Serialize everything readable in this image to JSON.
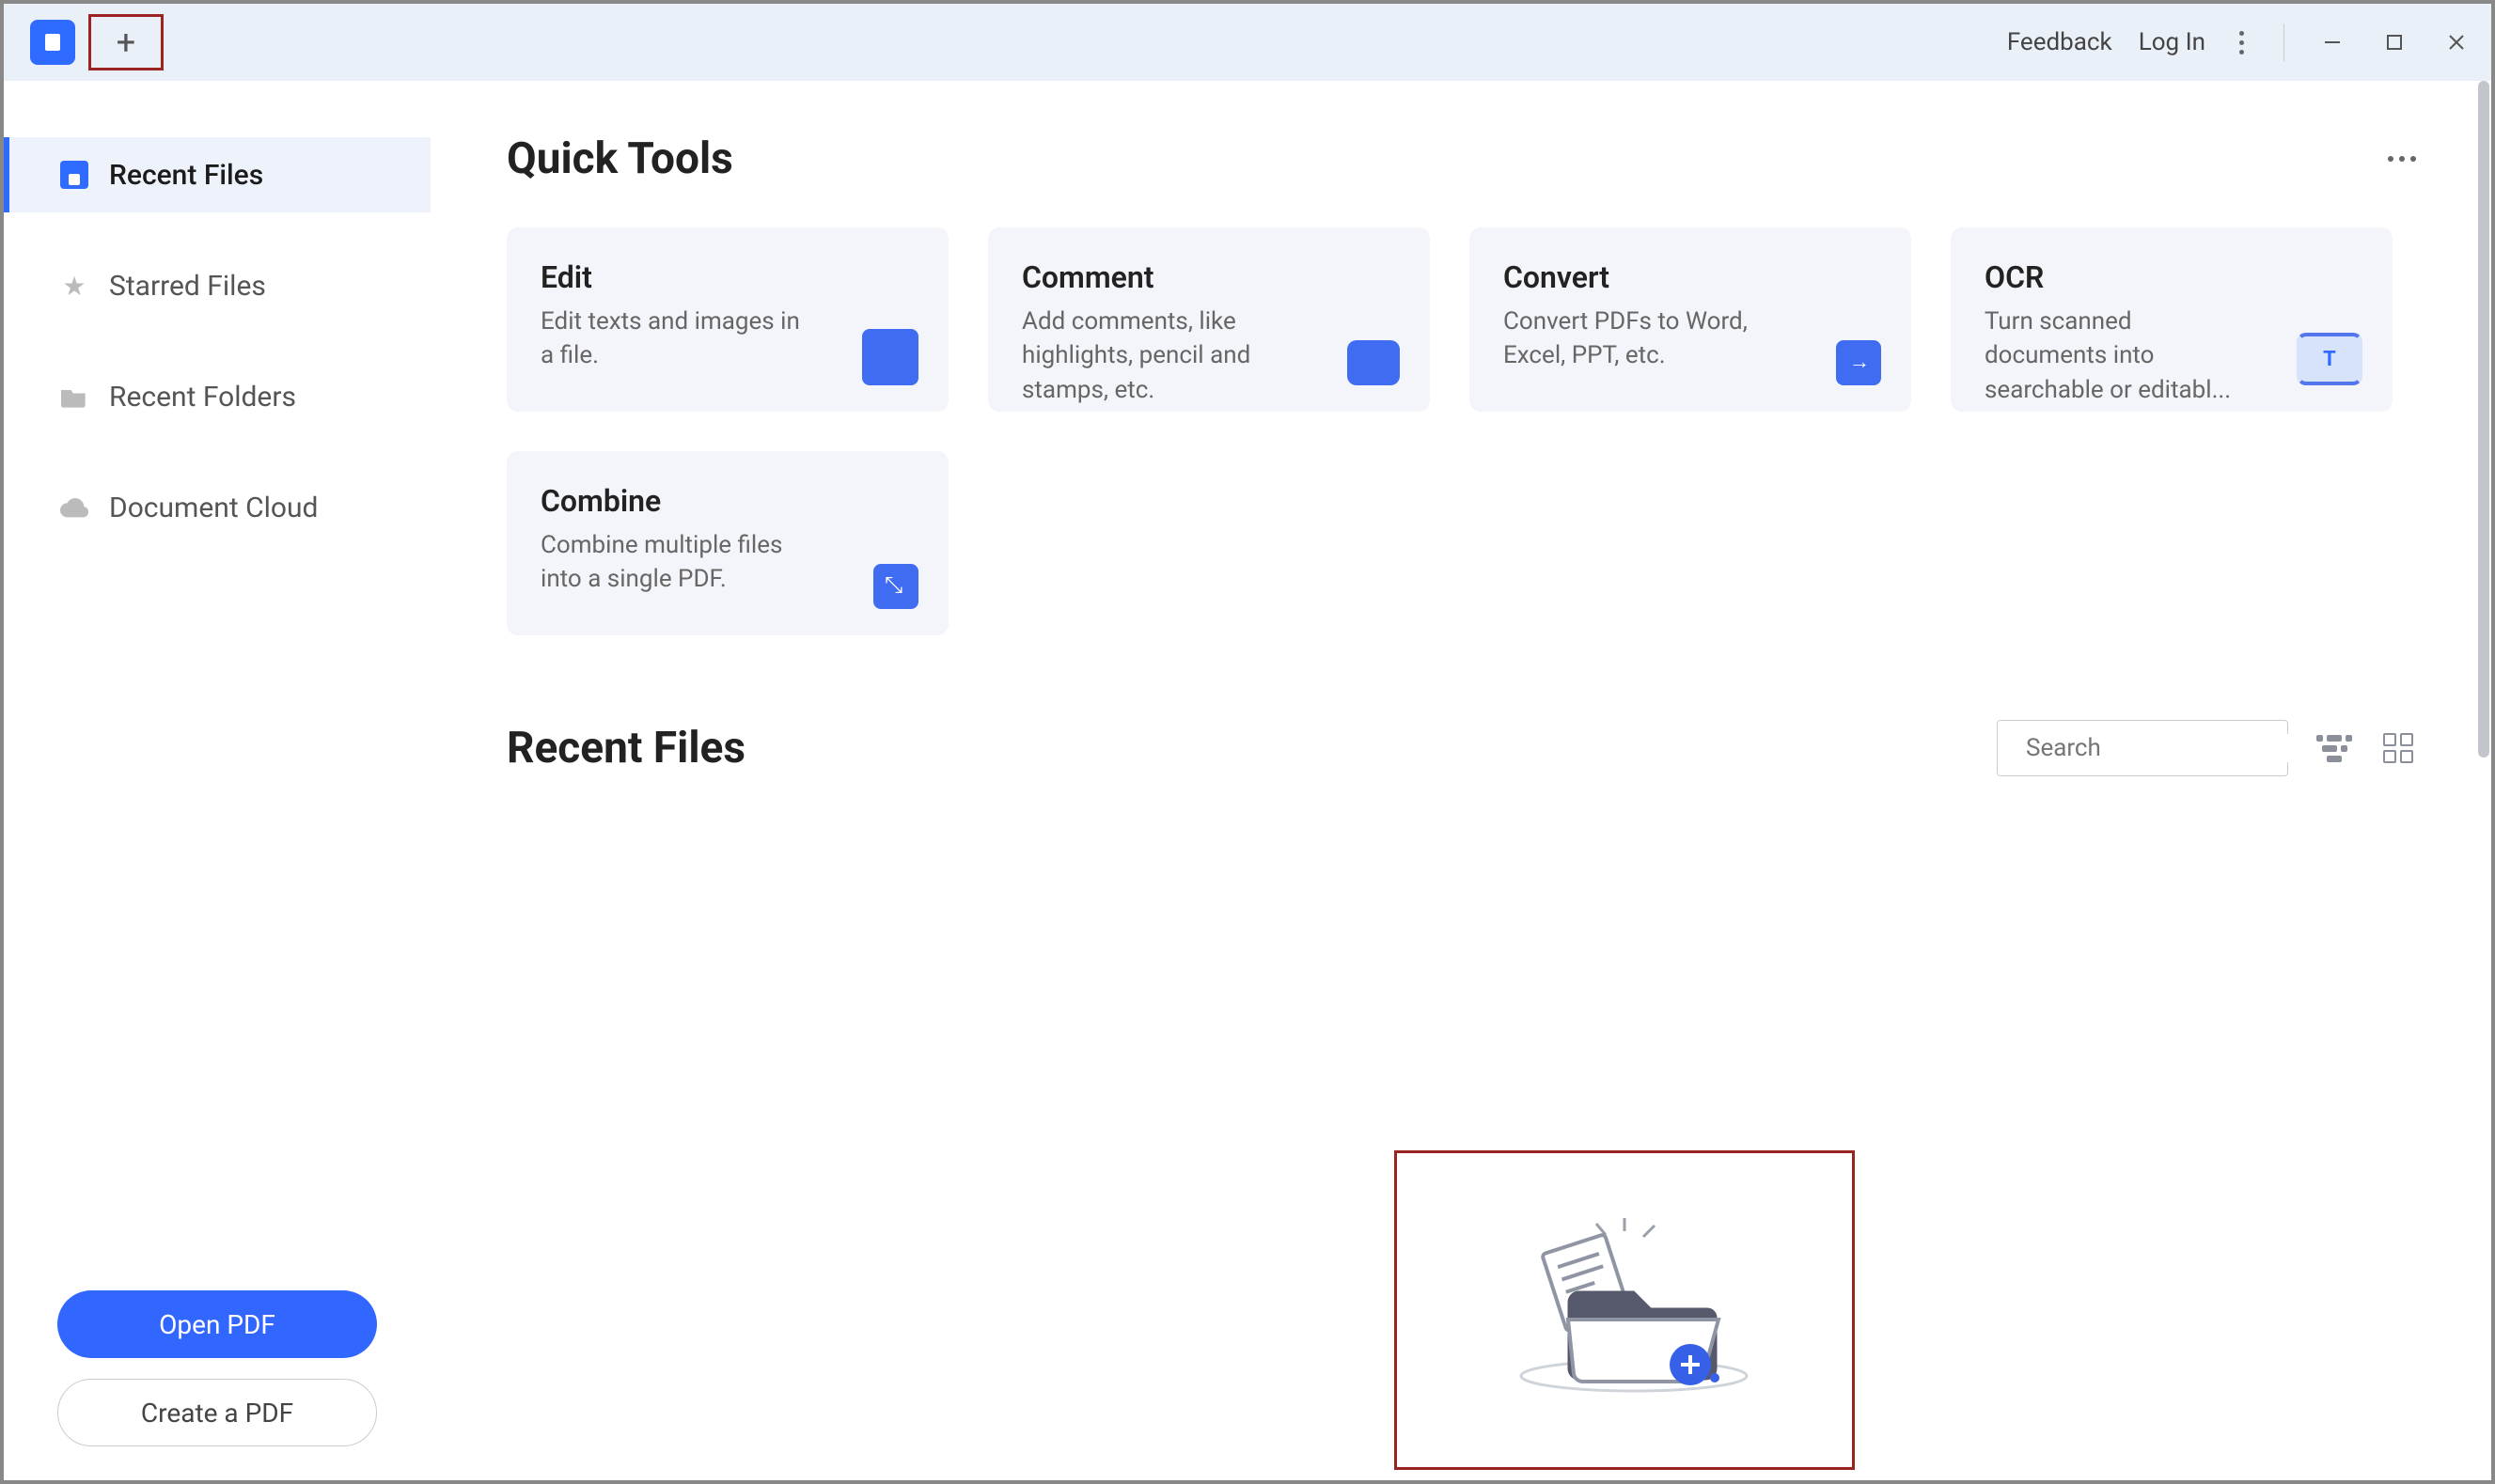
{
  "titlebar": {
    "feedback": "Feedback",
    "login": "Log In"
  },
  "sidebar": {
    "items": [
      {
        "label": "Recent Files",
        "icon": "file-icon",
        "active": true
      },
      {
        "label": "Starred Files",
        "icon": "star-icon",
        "active": false
      },
      {
        "label": "Recent Folders",
        "icon": "folder-icon",
        "active": false
      },
      {
        "label": "Document Cloud",
        "icon": "cloud-icon",
        "active": false
      }
    ],
    "open_label": "Open PDF",
    "create_label": "Create a PDF"
  },
  "quick_tools": {
    "title": "Quick Tools",
    "cards": [
      {
        "title": "Edit",
        "desc": "Edit texts and images in a file.",
        "icon": "edit-icon"
      },
      {
        "title": "Comment",
        "desc": "Add comments, like highlights, pencil and stamps, etc.",
        "icon": "comment-icon"
      },
      {
        "title": "Convert",
        "desc": "Convert PDFs to Word, Excel, PPT, etc.",
        "icon": "convert-icon"
      },
      {
        "title": "OCR",
        "desc": "Turn scanned documents into searchable or editabl...",
        "icon": "ocr-icon"
      },
      {
        "title": "Combine",
        "desc": "Combine multiple files into a single PDF.",
        "icon": "combine-icon"
      }
    ]
  },
  "recent_files": {
    "title": "Recent Files",
    "search_placeholder": "Search"
  }
}
